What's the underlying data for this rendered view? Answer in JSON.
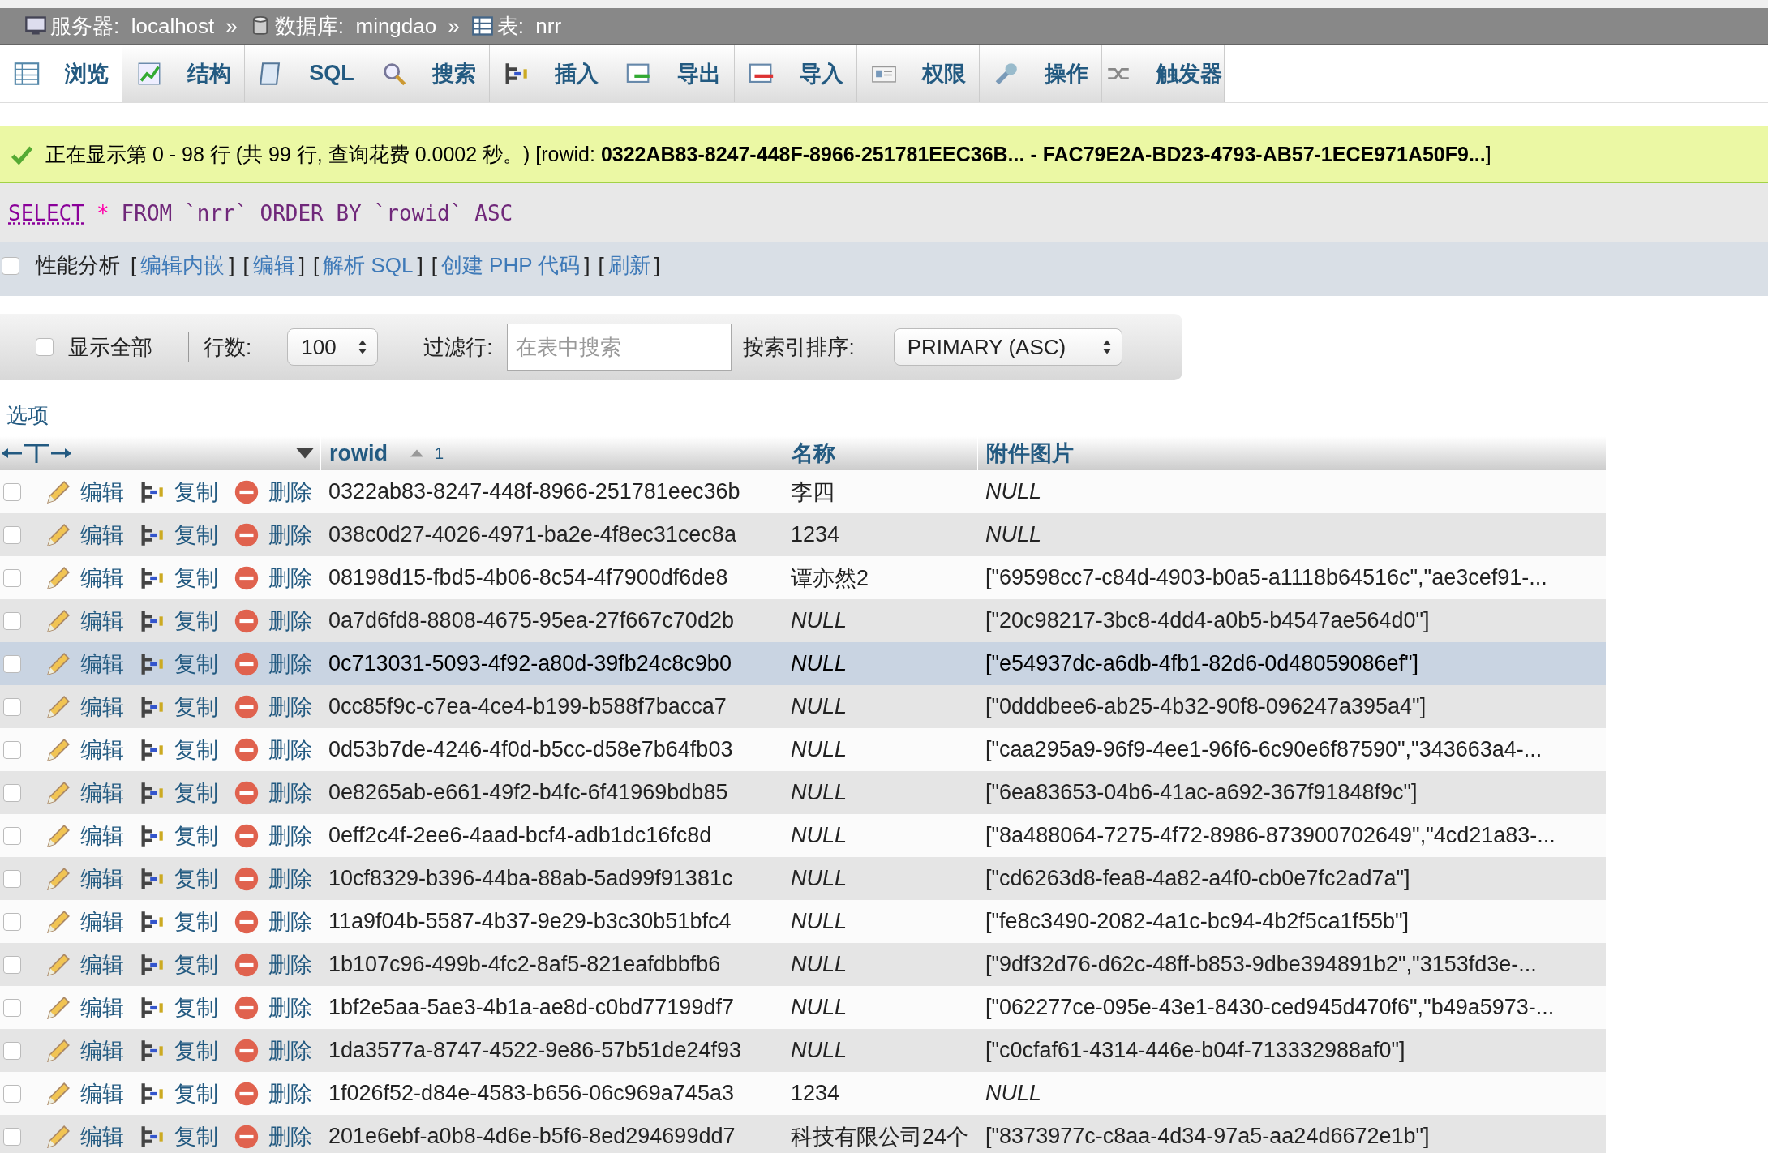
{
  "breadcrumb": [
    {
      "kind": "server",
      "label": "服务器:",
      "value": "localhost",
      "separator": "»"
    },
    {
      "kind": "database",
      "label": "数据库:",
      "value": "mingdao",
      "separator": "»"
    },
    {
      "kind": "table",
      "label": "表:",
      "value": "nrr"
    }
  ],
  "tabs": [
    {
      "kind": "browse",
      "label": "浏览",
      "selected": true
    },
    {
      "kind": "structure",
      "label": "结构",
      "selected": false
    },
    {
      "kind": "sql",
      "label": "SQL",
      "selected": false
    },
    {
      "kind": "search",
      "label": "搜索",
      "selected": false
    },
    {
      "kind": "insert",
      "label": "插入",
      "selected": false
    },
    {
      "kind": "export",
      "label": "导出",
      "selected": false
    },
    {
      "kind": "import",
      "label": "导入",
      "selected": false
    },
    {
      "kind": "privileges",
      "label": "权限",
      "selected": false
    },
    {
      "kind": "operations",
      "label": "操作",
      "selected": false
    },
    {
      "kind": "triggers",
      "label": "触发器",
      "selected": false
    }
  ],
  "message": "正在显示第 0 - 98 行 (共 99 行, 查询花费 0.0002 秒。) [rowid: **0322AB83-8247-448F-8966-251781EEC36B... - FAC79E2A-BD23-4793-AB57-1ECE971A50F9...**]",
  "sql": [
    {
      "kind": "keyword-link",
      "text": "SELECT"
    },
    {
      "kind": "operator",
      "text": "*"
    },
    {
      "kind": "keyword",
      "text": "FROM"
    },
    {
      "kind": "identifier",
      "text": "`nrr`"
    },
    {
      "kind": "keyword",
      "text": "ORDER BY"
    },
    {
      "kind": "identifier",
      "text": "`rowid`"
    },
    {
      "kind": "keyword",
      "text": "ASC"
    }
  ],
  "profiling": {
    "checked": false,
    "label": "性能分析",
    "bracket_open": "[",
    "bracket_close": "]",
    "links": [
      "编辑内嵌",
      "编辑",
      "解析 SQL",
      "创建 PHP 代码",
      "刷新"
    ]
  },
  "controls": {
    "show_all": {
      "label": "显示全部",
      "checked": false
    },
    "rows": {
      "label": "行数:",
      "value": "100"
    },
    "filter": {
      "label": "过滤行:",
      "placeholder": "在表中搜索"
    },
    "sort": {
      "label": "按索引排序:",
      "value": "PRIMARY (ASC)"
    }
  },
  "options_link": "选项",
  "columns": [
    {
      "label": "rowid",
      "sort_order": "1"
    },
    {
      "label": "名称"
    },
    {
      "label": "附件图片"
    }
  ],
  "rows": [
    {
      "checked": false,
      "selected": false,
      "edit": "编辑",
      "copy": "复制",
      "delete": "删除",
      "rowid": "0322ab83-8247-448f-8966-251781eec36b",
      "cells": [
        {
          "kind": "value",
          "text": "李四"
        },
        {
          "kind": "null",
          "text": "NULL"
        }
      ]
    },
    {
      "checked": false,
      "selected": false,
      "edit": "编辑",
      "copy": "复制",
      "delete": "删除",
      "rowid": "038c0d27-4026-4971-ba2e-4f8ec31cec8a",
      "cells": [
        {
          "kind": "value",
          "text": "1234"
        },
        {
          "kind": "null",
          "text": "NULL"
        }
      ]
    },
    {
      "checked": false,
      "selected": false,
      "edit": "编辑",
      "copy": "复制",
      "delete": "删除",
      "rowid": "08198d15-fbd5-4b06-8c54-4f7900df6de8",
      "cells": [
        {
          "kind": "value",
          "text": "谭亦然2"
        },
        {
          "kind": "value",
          "text": "[\"69598cc7-c84d-4903-b0a5-a1118b64516c\",\"ae3cef91-..."
        }
      ]
    },
    {
      "checked": false,
      "selected": false,
      "edit": "编辑",
      "copy": "复制",
      "delete": "删除",
      "rowid": "0a7d6fd8-8808-4675-95ea-27f667c70d2b",
      "cells": [
        {
          "kind": "null",
          "text": "NULL"
        },
        {
          "kind": "value",
          "text": "[\"20c98217-3bc8-4dd4-a0b5-b4547ae564d0\"]"
        }
      ]
    },
    {
      "checked": false,
      "selected": true,
      "edit": "编辑",
      "copy": "复制",
      "delete": "删除",
      "rowid": "0c713031-5093-4f92-a80d-39fb24c8c9b0",
      "cells": [
        {
          "kind": "null",
          "text": "NULL"
        },
        {
          "kind": "value",
          "text": "[\"e54937dc-a6db-4fb1-82d6-0d48059086ef\"]"
        }
      ]
    },
    {
      "checked": false,
      "selected": false,
      "edit": "编辑",
      "copy": "复制",
      "delete": "删除",
      "rowid": "0cc85f9c-c7ea-4ce4-b199-b588f7bacca7",
      "cells": [
        {
          "kind": "null",
          "text": "NULL"
        },
        {
          "kind": "value",
          "text": "[\"0dddbee6-ab25-4b32-90f8-096247a395a4\"]"
        }
      ]
    },
    {
      "checked": false,
      "selected": false,
      "edit": "编辑",
      "copy": "复制",
      "delete": "删除",
      "rowid": "0d53b7de-4246-4f0d-b5cc-d58e7b64fb03",
      "cells": [
        {
          "kind": "null",
          "text": "NULL"
        },
        {
          "kind": "value",
          "text": "[\"caa295a9-96f9-4ee1-96f6-6c90e6f87590\",\"343663a4-..."
        }
      ]
    },
    {
      "checked": false,
      "selected": false,
      "edit": "编辑",
      "copy": "复制",
      "delete": "删除",
      "rowid": "0e8265ab-e661-49f2-b4fc-6f41969bdb85",
      "cells": [
        {
          "kind": "null",
          "text": "NULL"
        },
        {
          "kind": "value",
          "text": "[\"6ea83653-04b6-41ac-a692-367f91848f9c\"]"
        }
      ]
    },
    {
      "checked": false,
      "selected": false,
      "edit": "编辑",
      "copy": "复制",
      "delete": "删除",
      "rowid": "0eff2c4f-2ee6-4aad-bcf4-adb1dc16fc8d",
      "cells": [
        {
          "kind": "null",
          "text": "NULL"
        },
        {
          "kind": "value",
          "text": "[\"8a488064-7275-4f72-8986-873900702649\",\"4cd21a83-..."
        }
      ]
    },
    {
      "checked": false,
      "selected": false,
      "edit": "编辑",
      "copy": "复制",
      "delete": "删除",
      "rowid": "10cf8329-b396-44ba-88ab-5ad99f91381c",
      "cells": [
        {
          "kind": "null",
          "text": "NULL"
        },
        {
          "kind": "value",
          "text": "[\"cd6263d8-fea8-4a82-a4f0-cb0e7fc2ad7a\"]"
        }
      ]
    },
    {
      "checked": false,
      "selected": false,
      "edit": "编辑",
      "copy": "复制",
      "delete": "删除",
      "rowid": "11a9f04b-5587-4b37-9e29-b3c30b51bfc4",
      "cells": [
        {
          "kind": "null",
          "text": "NULL"
        },
        {
          "kind": "value",
          "text": "[\"fe8c3490-2082-4a1c-bc94-4b2f5ca1f55b\"]"
        }
      ]
    },
    {
      "checked": false,
      "selected": false,
      "edit": "编辑",
      "copy": "复制",
      "delete": "删除",
      "rowid": "1b107c96-499b-4fc2-8af5-821eafdbbfb6",
      "cells": [
        {
          "kind": "null",
          "text": "NULL"
        },
        {
          "kind": "value",
          "text": "[\"9df32d76-d62c-48ff-b853-9dbe394891b2\",\"3153fd3e-..."
        }
      ]
    },
    {
      "checked": false,
      "selected": false,
      "edit": "编辑",
      "copy": "复制",
      "delete": "删除",
      "rowid": "1bf2e5aa-5ae3-4b1a-ae8d-c0bd77199df7",
      "cells": [
        {
          "kind": "null",
          "text": "NULL"
        },
        {
          "kind": "value",
          "text": "[\"062277ce-095e-43e1-8430-ced945d470f6\",\"b49a5973-..."
        }
      ]
    },
    {
      "checked": false,
      "selected": false,
      "edit": "编辑",
      "copy": "复制",
      "delete": "删除",
      "rowid": "1da3577a-8747-4522-9e86-57b51de24f93",
      "cells": [
        {
          "kind": "null",
          "text": "NULL"
        },
        {
          "kind": "value",
          "text": "[\"c0cfaf61-4314-446e-b04f-713332988af0\"]"
        }
      ]
    },
    {
      "checked": false,
      "selected": false,
      "edit": "编辑",
      "copy": "复制",
      "delete": "删除",
      "rowid": "1f026f52-d84e-4583-b656-06c969a745a3",
      "cells": [
        {
          "kind": "value",
          "text": "1234"
        },
        {
          "kind": "null",
          "text": "NULL"
        }
      ]
    },
    {
      "checked": false,
      "selected": false,
      "edit": "编辑",
      "copy": "复制",
      "delete": "删除",
      "rowid": "201e6ebf-a0b8-4d6e-b5f6-8ed294699dd7",
      "cells": [
        {
          "kind": "value",
          "text": "科技有限公司24个"
        },
        {
          "kind": "value",
          "text": "[\"8373977c-c8aa-4d34-97a5-aa24d6672e1b\"]"
        }
      ]
    }
  ]
}
